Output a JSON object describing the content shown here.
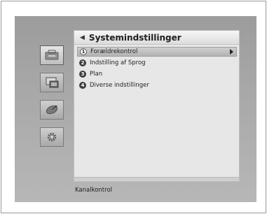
{
  "header": {
    "back_icon": "back-arrow-icon",
    "title": "Systemindstillinger"
  },
  "sidebar": {
    "items": [
      {
        "name": "parental-control-icon",
        "selected": true
      },
      {
        "name": "display-settings-icon",
        "selected": false
      },
      {
        "name": "satellite-dish-icon",
        "selected": false
      },
      {
        "name": "settings-gear-icon",
        "selected": false
      }
    ]
  },
  "menu": {
    "items": [
      {
        "number": "1",
        "label": "Forældrekontrol",
        "selected": true
      },
      {
        "number": "2",
        "label": "Indstilling af Sprog",
        "selected": false
      },
      {
        "number": "3",
        "label": "Plan",
        "selected": false
      },
      {
        "number": "4",
        "label": "Diverse indstillinger",
        "selected": false
      }
    ]
  },
  "status": {
    "text": "Kanalkontrol"
  },
  "colors": {
    "screen_bg": "#a8a8a8",
    "panel_bg": "#e7e7e7",
    "highlight": "#bdbdbd"
  }
}
